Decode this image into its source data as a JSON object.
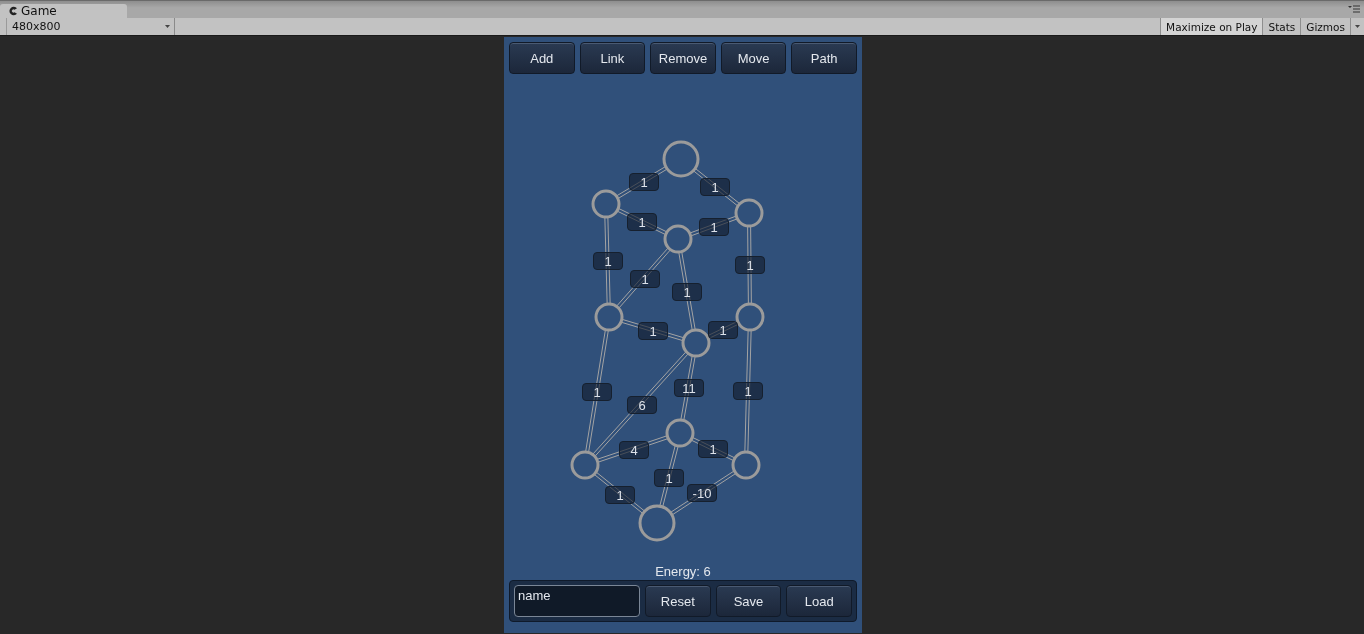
{
  "window": {
    "tab_title": "Game"
  },
  "toolbar": {
    "resolution": "480x800",
    "buttons": [
      "Maximize on Play",
      "Stats",
      "Gizmos"
    ]
  },
  "tool_buttons": [
    "Add",
    "Link",
    "Remove",
    "Move",
    "Path"
  ],
  "graph": {
    "edges": [
      {
        "weight": "1"
      },
      {
        "weight": "1"
      },
      {
        "weight": "1"
      },
      {
        "weight": "1"
      },
      {
        "weight": "1"
      },
      {
        "weight": "1"
      },
      {
        "weight": "1"
      },
      {
        "weight": "1"
      },
      {
        "weight": "1"
      },
      {
        "weight": "1"
      },
      {
        "weight": "1"
      },
      {
        "weight": "6"
      },
      {
        "weight": "11"
      },
      {
        "weight": "1"
      },
      {
        "weight": "4"
      },
      {
        "weight": "1"
      },
      {
        "weight": "1"
      },
      {
        "weight": "1"
      },
      {
        "weight": "-10"
      }
    ]
  },
  "energy": "Energy: 6",
  "name_field": {
    "value": "name"
  },
  "action_buttons": [
    "Reset",
    "Save",
    "Load"
  ]
}
